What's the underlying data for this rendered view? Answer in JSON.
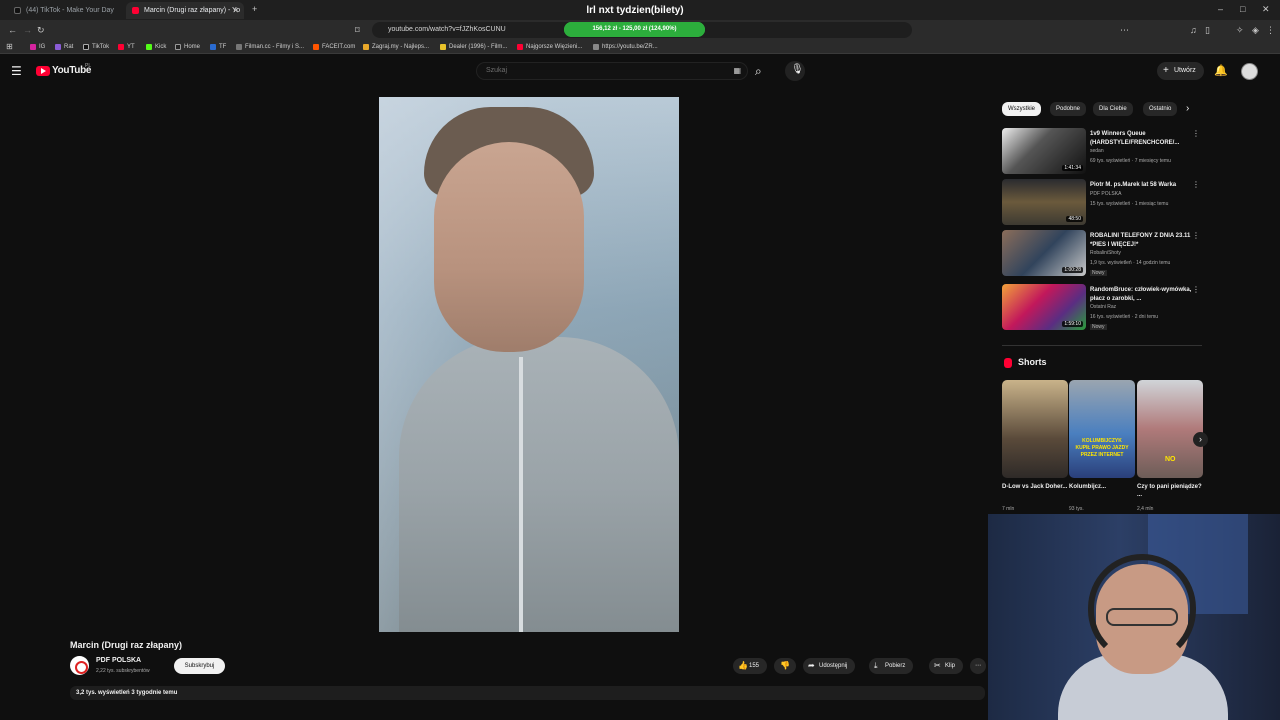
{
  "browser": {
    "tabs": [
      {
        "label": "(44) TikTok - Make Your Day",
        "active": false
      },
      {
        "label": "Marcin (Drugi raz złapany) - Yo",
        "active": true
      }
    ],
    "url": "youtube.com/watch?v=fJZhKosCUNU",
    "bookmarks": [
      "IG",
      "Rat",
      "TikTok",
      "YT",
      "Kick",
      "Home",
      "TF",
      "Filman.cc - Filmy i S...",
      "FACEIT.com",
      "Zagraj.my - Najleps...",
      "Dealer (1996) - Film...",
      "Najgorsze Więzieni...",
      "https://youtu.be/ZR..."
    ]
  },
  "overlay": {
    "stream_title": "lrl nxt tydzien(bilety)",
    "goal_text": "156,12 zł - 125,00 zł (124,90%)",
    "goal_fraction": 1.0
  },
  "header": {
    "logo": "YouTube",
    "logo_region": "PL",
    "search_placeholder": "Szukaj",
    "create_label": "Utwórz"
  },
  "video": {
    "title": "Marcin (Drugi raz złapany)",
    "channel": "PDF POLSKA",
    "subs": "2,22 tys. subskrybentów",
    "subscribe_label": "Subskrybuj",
    "likes": "155",
    "share_label": "Udostępnij",
    "download_label": "Pobierz",
    "clip_label": "Klip",
    "views_date": "3,2 tys. wyświetleń  3 tygodnie temu"
  },
  "sidebar": {
    "chips": [
      "Wszystkie",
      "Podobne",
      "Dla Ciebie",
      "Ostatnio"
    ],
    "recommendations": [
      {
        "title": "1v9 Winners Queue (HARDSTYLE/FRENCHCORE/...",
        "channel": "sedan",
        "meta": "69 tys. wyświetleń · 7 miesięcy temu",
        "duration": "1:41:34",
        "badge": ""
      },
      {
        "title": "Piotr M. ps.Marek lat 58 Warka",
        "channel": "PDF POLSKA",
        "meta": "15 tys. wyświetleń · 1 miesiąc temu",
        "duration": "48:50",
        "badge": ""
      },
      {
        "title": "ROBALINI TELEFONY Z DNIA 23.11 *PIES I WIĘCEJ!*",
        "channel": "RobaliniShoty",
        "meta": "1,9 tys. wyświetleń · 14 godzin temu",
        "duration": "1:00:28",
        "badge": "Nowy"
      },
      {
        "title": "RandomBruce: człowiek-wymówka, płacz o zarobki, ...",
        "channel": "Ostatni Raz",
        "meta": "16 tys. wyświetleń · 2 dni temu",
        "duration": "1:59:10",
        "badge": "Nowy"
      }
    ],
    "shorts_label": "Shorts",
    "shorts": [
      {
        "title": "D-Low vs Jack Doher...",
        "views": "7 mln"
      },
      {
        "title": "Kolumbijcz...",
        "views": "93 tys."
      },
      {
        "title": "Czy to pani pieniądze? ...",
        "views": "2,4 mln"
      }
    ]
  },
  "colors": {
    "accent_red": "#ff0033",
    "goal_green": "#39c94a",
    "bg": "#0f0f0f"
  }
}
